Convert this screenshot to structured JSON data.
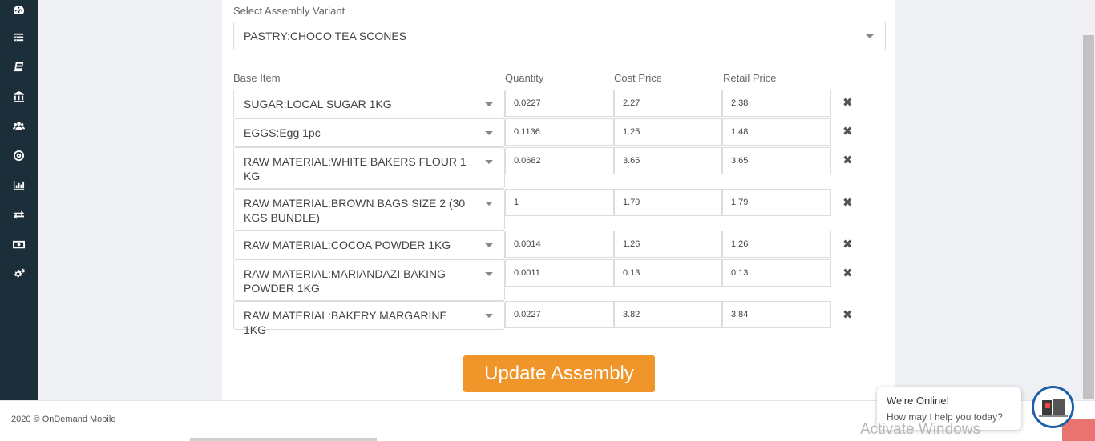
{
  "sidebar": {
    "icons": [
      "dashboard-icon",
      "list-icon",
      "book-icon",
      "bank-icon",
      "users-icon",
      "target-icon",
      "bar-chart-icon",
      "exchange-icon",
      "money-icon",
      "settings-icon"
    ]
  },
  "form": {
    "variant_label": "Select Assembly Variant",
    "variant_value": "PASTRY:CHOCO TEA SCONES",
    "headers": {
      "base_item": "Base Item",
      "quantity": "Quantity",
      "cost_price": "Cost Price",
      "retail_price": "Retail Price"
    },
    "rows": [
      {
        "item": "SUGAR:LOCAL SUGAR 1KG",
        "qty": "0.0227",
        "cost": "2.27",
        "retail": "2.38"
      },
      {
        "item": "EGGS:Egg 1pc",
        "qty": "0.1136",
        "cost": "1.25",
        "retail": "1.48"
      },
      {
        "item": "RAW MATERIAL:WHITE BAKERS FLOUR 1 KG",
        "qty": "0.0682",
        "cost": "3.65",
        "retail": "3.65"
      },
      {
        "item": "RAW MATERIAL:BROWN BAGS SIZE 2 (30 KGS BUNDLE)",
        "qty": "1",
        "cost": "1.79",
        "retail": "1.79"
      },
      {
        "item": "RAW MATERIAL:COCOA POWDER 1KG",
        "qty": "0.0014",
        "cost": "1.26",
        "retail": "1.26"
      },
      {
        "item": "RAW MATERIAL:MARIANDAZI BAKING POWDER 1KG",
        "qty": "0.0011",
        "cost": "0.13",
        "retail": "0.13"
      },
      {
        "item": "RAW MATERIAL:BAKERY MARGARINE 1KG",
        "qty": "0.0227",
        "cost": "3.82",
        "retail": "3.84"
      }
    ],
    "delete_glyph": "✖",
    "submit_label": "Update Assembly"
  },
  "footer": {
    "copyright": "2020 © OnDemand Mobile"
  },
  "chat": {
    "title": "We're Online!",
    "subtitle": "How may I help you today?"
  },
  "watermark": "Activate Windows"
}
